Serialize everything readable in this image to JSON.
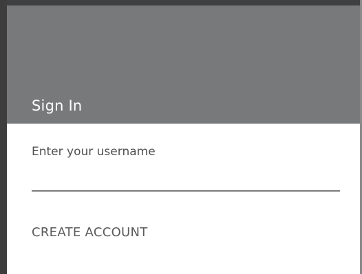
{
  "dialog": {
    "title": "Sign In",
    "username_field": {
      "value": "",
      "placeholder": "Enter your username"
    },
    "create_account_label": "CREATE ACCOUNT"
  }
}
